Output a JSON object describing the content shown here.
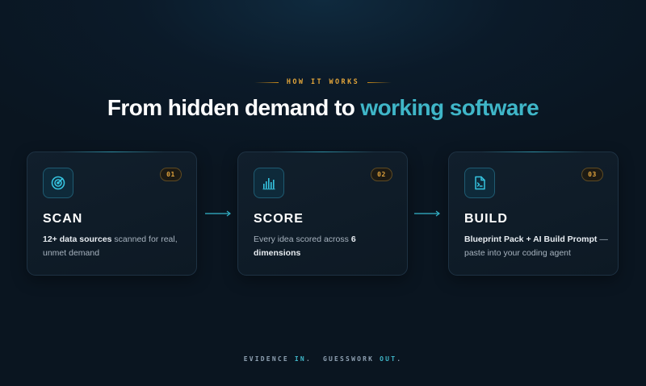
{
  "section": {
    "eyebrow": "HOW IT WORKS",
    "headline_main": "From hidden demand to",
    "headline_accent": "working software"
  },
  "steps": [
    {
      "number": "01",
      "title": "SCAN",
      "icon": "radar-icon",
      "desc_bold": "12+ data sources",
      "desc_rest": " scanned for real, unmet demand"
    },
    {
      "number": "02",
      "title": "SCORE",
      "icon": "bar-chart-icon",
      "desc_rest": "Every idea scored across ",
      "desc_bold": "6 dimensions"
    },
    {
      "number": "03",
      "title": "BUILD",
      "icon": "terminal-file-icon",
      "desc_bold": "Blueprint Pack + AI Build Prompt",
      "desc_rest": " — paste into your coding agent"
    }
  ],
  "tagline": {
    "part1": "EVIDENCE ",
    "hl1": "IN",
    "part2": ".  GUESSWORK ",
    "hl2": "OUT",
    "part3": "."
  },
  "colors": {
    "accent": "#3fb6c8",
    "badge": "#e2a33c",
    "background": "#0a1520"
  }
}
